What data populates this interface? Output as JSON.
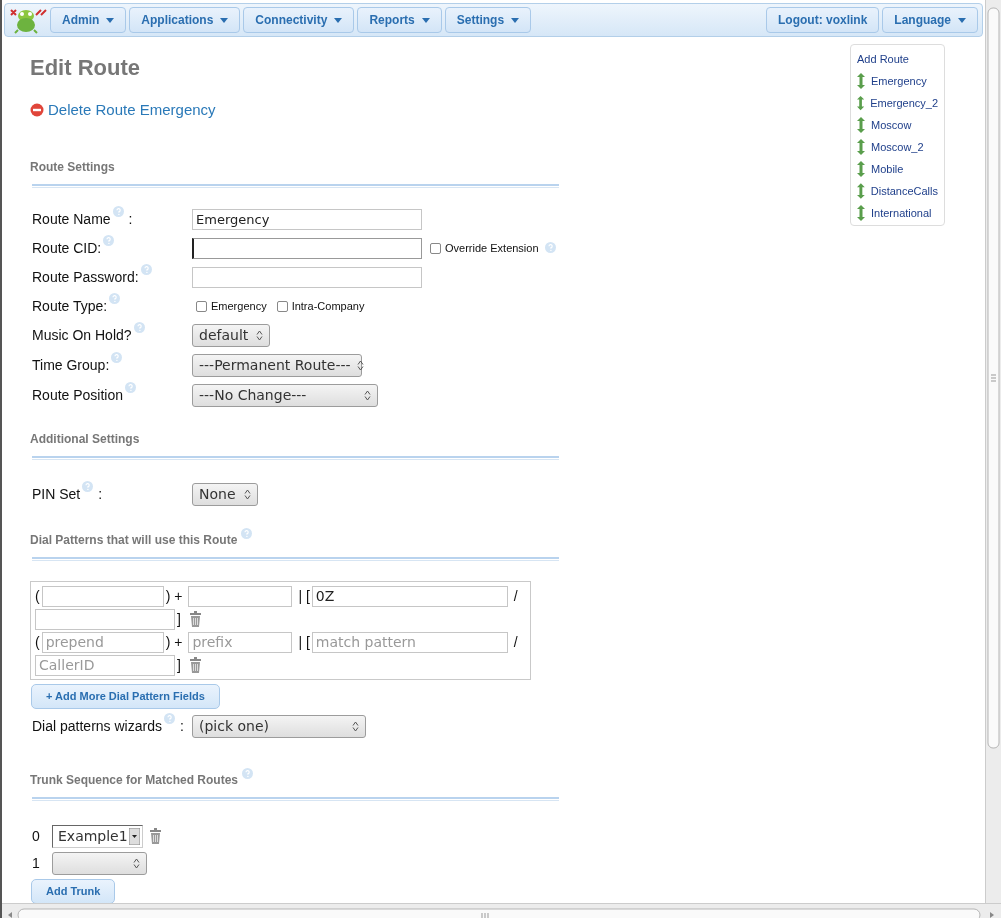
{
  "navbar": {
    "menus": [
      {
        "label": "Admin",
        "caret": true
      },
      {
        "label": "Applications",
        "caret": true
      },
      {
        "label": "Connectivity",
        "caret": true
      },
      {
        "label": "Reports",
        "caret": true
      },
      {
        "label": "Settings",
        "caret": true
      }
    ],
    "right_menus": [
      {
        "label": "Logout: voxlink",
        "caret": false
      },
      {
        "label": "Language",
        "caret": true
      }
    ]
  },
  "title": "Edit Route",
  "delete_link": "Delete Route Emergency",
  "route_settings": {
    "heading": "Route Settings",
    "fields": [
      {
        "kind": "text",
        "label": "Route Name",
        "help": true,
        "colon": ":",
        "value": "Emergency"
      },
      {
        "kind": "text",
        "label": "Route CID:",
        "help": true,
        "focused": true,
        "checkbox": {
          "label": "Override Extension",
          "checked": false,
          "help": true
        }
      },
      {
        "kind": "text",
        "label": "Route Password:",
        "help": true
      },
      {
        "kind": "checks",
        "label": "Route Type:",
        "help": true,
        "options": [
          {
            "label": "Emergency",
            "checked": false
          },
          {
            "label": "Intra-Company",
            "checked": false
          }
        ]
      },
      {
        "kind": "select",
        "label": "Music On Hold?",
        "help": true,
        "value": "default"
      },
      {
        "kind": "select",
        "label": "Time Group:",
        "help": true,
        "value": "---Permanent Route---"
      },
      {
        "kind": "select",
        "label": "Route Position",
        "help": true,
        "value": "---No Change---"
      }
    ]
  },
  "additional_settings": {
    "heading": "Additional Settings",
    "fields": [
      {
        "kind": "select",
        "label": "PIN Set",
        "help": true,
        "colon": ":",
        "value": "None"
      }
    ]
  },
  "dial_patterns": {
    "heading": "Dial Patterns that will use this Route",
    "help": true,
    "rows": [
      {
        "open": "(",
        "prepend": {},
        "plus": ") +",
        "prefix": {},
        "bar": "| [",
        "match": {
          "value": "0Z"
        },
        "slash": "/",
        "callerid": {},
        "close": "]"
      },
      {
        "open": "(",
        "prepend": {
          "placeholder": "prepend"
        },
        "plus": ") +",
        "prefix": {
          "placeholder": "prefix"
        },
        "bar": "| [",
        "match": {
          "placeholder": "match pattern"
        },
        "slash": "/",
        "callerid": {
          "placeholder": "CallerID"
        },
        "close": "]"
      }
    ],
    "add_button": "+ Add More Dial Pattern Fields",
    "wizard": {
      "label": "Dial patterns wizards",
      "help": true,
      "colon": ":",
      "value": "(pick one)"
    }
  },
  "trunk_sequence": {
    "heading": "Trunk Sequence for Matched Routes",
    "help": true,
    "trunks": [
      {
        "index": "0",
        "kind": "listbox",
        "value": "Example1",
        "removable": true
      },
      {
        "index": "1",
        "kind": "select",
        "removable": false
      }
    ],
    "add_button": "Add Trunk"
  },
  "route_list": {
    "add_label": "Add Route",
    "routes": [
      {
        "name": "Emergency"
      },
      {
        "name": "Emergency_2"
      },
      {
        "name": "Moscow"
      },
      {
        "name": "Moscow_2"
      },
      {
        "name": "Mobile"
      },
      {
        "name": "DistanceCalls"
      },
      {
        "name": "International"
      }
    ]
  }
}
